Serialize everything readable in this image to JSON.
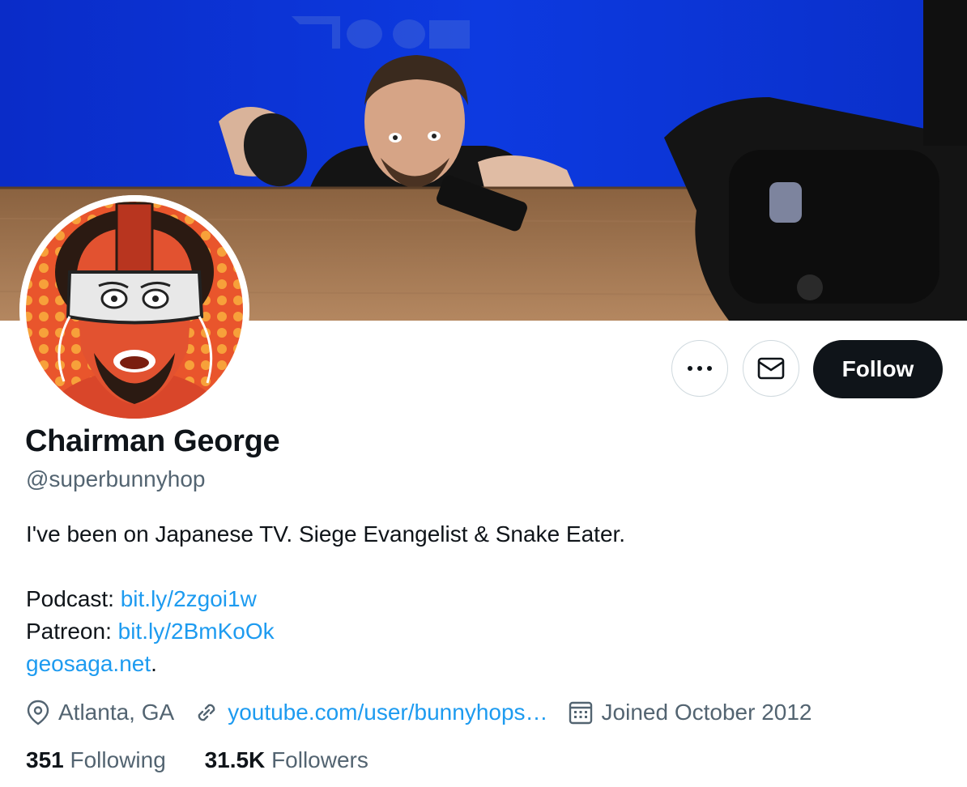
{
  "profile": {
    "display_name": "Chairman George",
    "handle": "@superbunnyhop",
    "bio": {
      "line1": "I've been on Japanese TV. Siege Evangelist & Snake Eater.",
      "podcast_label": "Podcast: ",
      "podcast_link": "bit.ly/2zgoi1w",
      "patreon_label": "Patreon: ",
      "patreon_link": "bit.ly/2BmKoOk",
      "site_link": "geosaga.net",
      "site_suffix": "."
    },
    "location": "Atlanta, GA",
    "website": "youtube.com/user/bunnyhops…",
    "joined": "Joined October 2012",
    "following_count": "351",
    "following_label": "Following",
    "followers_count": "31.5K",
    "followers_label": "Followers"
  },
  "actions": {
    "follow_label": "Follow"
  },
  "icons": {
    "more": "more-dots-icon",
    "message": "envelope-icon",
    "location": "location-pin-icon",
    "link": "link-icon",
    "calendar": "calendar-icon"
  },
  "colors": {
    "accent": "#1d9bf0",
    "text": "#0f1419",
    "secondary": "#536471",
    "banner_bg": "#0b31d6",
    "follow_bg": "#0f1419"
  }
}
